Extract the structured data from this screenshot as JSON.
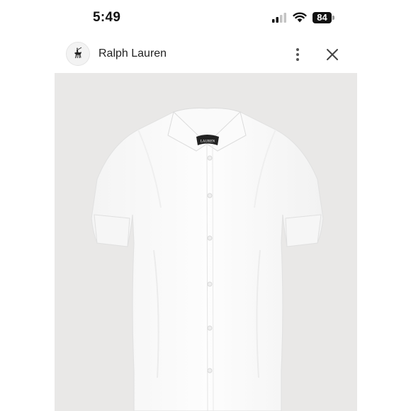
{
  "status_bar": {
    "time": "5:49",
    "battery_level": "84",
    "icons": [
      "cellular-signal-icon",
      "wifi-icon",
      "battery-icon"
    ]
  },
  "app_bar": {
    "title": "Ralph Lauren",
    "logo_icon": "polo-player-logo-icon",
    "actions": [
      "more-vertical-icon",
      "close-icon"
    ]
  },
  "product": {
    "image": "white short-sleeve button-front linen shirt",
    "label_text": "LAUREN",
    "background_color": "#e9e8e7",
    "shirt_color": "#fbfbfb"
  }
}
